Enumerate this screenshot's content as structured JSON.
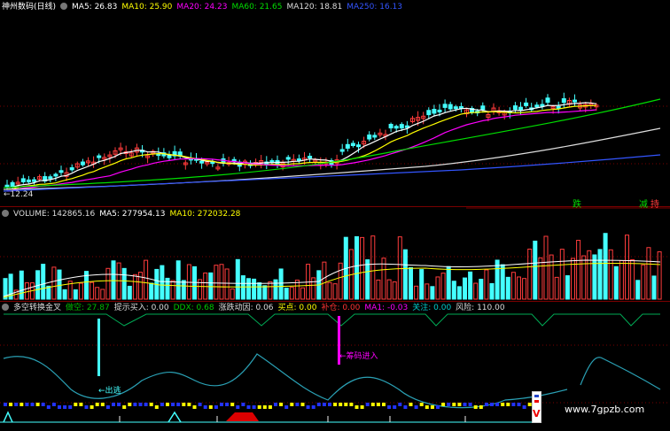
{
  "price_panel": {
    "title": "神州数码(日线)",
    "ma_labels": [
      {
        "text": "MA5: 26.83",
        "color": "#ffffff"
      },
      {
        "text": "MA10: 25.90",
        "color": "#ffff00"
      },
      {
        "text": "MA20: 24.23",
        "color": "#ff00ff"
      },
      {
        "text": "MA60: 21.65",
        "color": "#00dd00"
      },
      {
        "text": "MA120: 18.81",
        "color": "#dddddd"
      },
      {
        "text": "MA250: 16.13",
        "color": "#3355ff"
      }
    ],
    "low_label": "←12.24",
    "sig_up": "跌",
    "sig_reduce": "减",
    "sig_hold": "持"
  },
  "volume_panel": {
    "labels": [
      {
        "text": "VOLUME: 142865.16",
        "color": "#dddddd"
      },
      {
        "text": "MA5: 277954.13",
        "color": "#ffffff"
      },
      {
        "text": "MA10: 272032.28",
        "color": "#ffff00"
      }
    ]
  },
  "indicator_panel": {
    "labels": [
      {
        "text": "多空转换金叉",
        "color": "#dddddd"
      },
      {
        "text": "做空: 27.87",
        "color": "#00bb00"
      },
      {
        "text": "提示买入: 0.00",
        "color": "#dddddd"
      },
      {
        "text": "DDX: 0.68",
        "color": "#00cc00"
      },
      {
        "text": "涨跌动因: 0.06",
        "color": "#dddddd"
      },
      {
        "text": "买点: 0.00",
        "color": "#ffff00"
      },
      {
        "text": "补仓: 0.00",
        "color": "#ff3333"
      },
      {
        "text": "MA1: -0.03",
        "color": "#ff00ff"
      },
      {
        "text": "关注: 0.00",
        "color": "#00cccc"
      },
      {
        "text": "风险: 110.00",
        "color": "#dddddd"
      }
    ],
    "exit_label": "←出逃",
    "entry_label": "←筹码进入",
    "watermark": "www.7gpzb.com",
    "logo_letter": "V"
  },
  "colors": {
    "up": "#ff3c3c",
    "down": "#44ffff",
    "bg": "#000000",
    "grid": "#7a0000"
  },
  "chart_data": {
    "type": "candlestick",
    "title": "神州数码(日线)",
    "visible_min_price": 12.24,
    "moving_averages": {
      "MA5": 26.83,
      "MA10": 25.9,
      "MA20": 24.23,
      "MA60": 21.65,
      "MA120": 18.81,
      "MA250": 16.13
    },
    "volume": {
      "VOLUME": 142865.16,
      "MA5": 277954.13,
      "MA10": 272032.28
    },
    "indicators": {
      "做空": 27.87,
      "提示买入": 0.0,
      "DDX": 0.68,
      "涨跌动因": 0.06,
      "买点": 0.0,
      "补仓": 0.0,
      "MA1": -0.03,
      "关注": 0.0,
      "风险": 110.0
    }
  }
}
